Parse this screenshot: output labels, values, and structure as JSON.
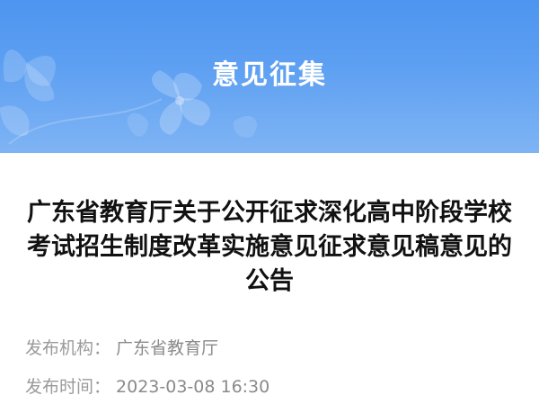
{
  "banner": {
    "title": "意见征集"
  },
  "article": {
    "title": "广东省教育厅关于公开征求深化高中阶段学校考试招生制度改革实施意见征求意见稿意见的公告"
  },
  "meta": {
    "publisher_label": "发布机构：",
    "publisher_value": "广东省教育厅",
    "time_label": "发布时间：",
    "time_value": "2023-03-08 16:30"
  },
  "colors": {
    "banner_top": "#4d95f0",
    "banner_bottom": "#7fb4f4",
    "title_text": "#111111",
    "meta_text": "#9a9a9a"
  }
}
